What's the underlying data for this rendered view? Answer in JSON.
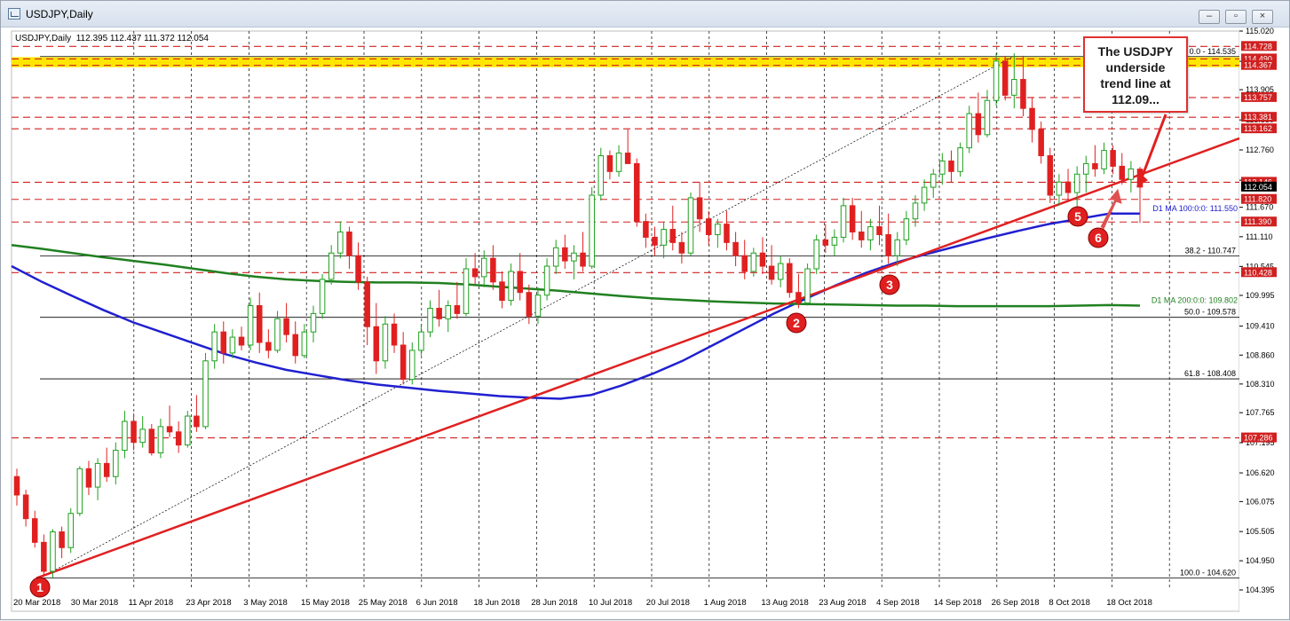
{
  "window": {
    "title": "USDJPY,Daily",
    "controls": {
      "minimize": "–",
      "maximize": "▫",
      "close": "×"
    }
  },
  "header": {
    "symbol_line": "USDJPY,Daily  112.395 112.437 111.372 112.054"
  },
  "callout": {
    "lines": [
      "The USDJPY",
      "underside",
      "trend line at",
      "112.09..."
    ]
  },
  "colors": {
    "bull": "#1fa01f",
    "bear": "#e02020",
    "trendline": "#e02020",
    "ma100": "#2020d0",
    "ma200": "#208020",
    "highlight": "#ffe600",
    "marker": "#e02020"
  },
  "chart_data": {
    "type": "candlestick",
    "symbol": "USDJPY",
    "timeframe": "Daily",
    "ohlc_last": {
      "open": 112.395,
      "high": 112.437,
      "low": 111.372,
      "close": 112.054
    },
    "ylim": [
      104.395,
      115.02
    ],
    "y_ticks": [
      "115.020",
      "114.445",
      "113.905",
      "113.330",
      "112.760",
      "112.185",
      "111.670",
      "111.110",
      "110.545",
      "109.995",
      "109.410",
      "108.860",
      "108.310",
      "107.765",
      "107.195",
      "106.620",
      "106.075",
      "105.505",
      "104.950",
      "104.395"
    ],
    "x_ticks": [
      "20 Mar 2018",
      "30 Mar 2018",
      "11 Apr 2018",
      "23 Apr 2018",
      "3 May 2018",
      "15 May 2018",
      "25 May 2018",
      "6 Jun 2018",
      "18 Jun 2018",
      "28 Jun 2018",
      "10 Jul 2018",
      "20 Jul 2018",
      "1 Aug 2018",
      "13 Aug 2018",
      "23 Aug 2018",
      "4 Sep 2018",
      "14 Sep 2018",
      "26 Sep 2018",
      "8 Oct 2018",
      "18 Oct 2018"
    ],
    "price_labels": [
      {
        "value": 114.728,
        "label": "114.728",
        "style": "red"
      },
      {
        "value": 114.49,
        "label": "114.490",
        "style": "red"
      },
      {
        "value": 114.367,
        "label": "114.367",
        "style": "red"
      },
      {
        "value": 113.757,
        "label": "113.757",
        "style": "red"
      },
      {
        "value": 113.381,
        "label": "113.381",
        "style": "red"
      },
      {
        "value": 113.162,
        "label": "113.162",
        "style": "red"
      },
      {
        "value": 112.146,
        "label": "112.146",
        "style": "red"
      },
      {
        "value": 112.054,
        "label": "112.054",
        "style": "black"
      },
      {
        "value": 111.82,
        "label": "111.820",
        "style": "red"
      },
      {
        "value": 111.39,
        "label": "111.390",
        "style": "red"
      },
      {
        "value": 110.428,
        "label": "110.428",
        "style": "red"
      },
      {
        "value": 107.286,
        "label": "107.286",
        "style": "red"
      }
    ],
    "horizontal_lines": [
      {
        "value": 114.728,
        "style": "red-dash"
      },
      {
        "value": 114.49,
        "style": "red-dash"
      },
      {
        "value": 114.367,
        "style": "red-dash"
      },
      {
        "value": 113.757,
        "style": "red-dash"
      },
      {
        "value": 113.381,
        "style": "red-dash"
      },
      {
        "value": 113.162,
        "style": "red-dash"
      },
      {
        "value": 112.146,
        "style": "red-dash"
      },
      {
        "value": 111.82,
        "style": "red-dash"
      },
      {
        "value": 111.39,
        "style": "red-dash"
      },
      {
        "value": 110.428,
        "style": "red-dash"
      },
      {
        "value": 107.286,
        "style": "red-dash"
      }
    ],
    "highlight_band": [
      114.367,
      114.49
    ],
    "fibonacci": {
      "levels": [
        {
          "value": 114.535,
          "label": "0.0 - 114.535"
        },
        {
          "value": 110.747,
          "label": "38.2 - 110.747"
        },
        {
          "value": 109.578,
          "label": "50.0 - 109.578"
        },
        {
          "value": 108.408,
          "label": "61.8 - 108.408"
        },
        {
          "value": 104.62,
          "label": "100.0 - 104.620"
        }
      ]
    },
    "ma_labels": [
      {
        "label": "D1 MA 100:0:0: 111.550",
        "value": 111.55,
        "color": "#2020d0"
      },
      {
        "label": "D1 MA 200:0:0: 109.802",
        "value": 109.802,
        "color": "#208020"
      }
    ],
    "trendline": {
      "from": [
        "20 Mar 2018",
        104.62
      ],
      "to": [
        "18 Oct 2018",
        112.09
      ]
    },
    "markers": [
      "1",
      "2",
      "3",
      "5",
      "6"
    ],
    "series": [
      {
        "name": "D1 MA 100",
        "values": [
          110.55,
          110.25,
          109.98,
          109.72,
          109.48,
          109.28,
          109.08,
          108.88,
          108.72,
          108.58,
          108.48,
          108.38,
          108.3,
          108.24,
          108.18,
          108.13,
          108.08,
          108.05,
          108.03,
          108.1,
          108.28,
          108.5,
          108.75,
          109.05,
          109.35,
          109.65,
          109.92,
          110.18,
          110.42,
          110.62,
          110.78,
          110.93,
          111.08,
          111.22,
          111.35,
          111.45,
          111.55,
          111.55
        ]
      },
      {
        "name": "D1 MA 200",
        "values": [
          110.95,
          110.88,
          110.8,
          110.72,
          110.65,
          110.58,
          110.5,
          110.42,
          110.35,
          110.3,
          110.27,
          110.25,
          110.24,
          110.24,
          110.23,
          110.2,
          110.16,
          110.12,
          110.08,
          110.03,
          109.98,
          109.94,
          109.91,
          109.88,
          109.86,
          109.84,
          109.83,
          109.82,
          109.81,
          109.8,
          109.8,
          109.79,
          109.79,
          109.79,
          109.79,
          109.8,
          109.81,
          109.8
        ]
      }
    ],
    "candles": [
      [
        106.55,
        106.7,
        106.0,
        106.2
      ],
      [
        106.2,
        106.3,
        105.6,
        105.75
      ],
      [
        105.75,
        105.9,
        105.2,
        105.3
      ],
      [
        105.3,
        105.45,
        104.64,
        104.75
      ],
      [
        104.75,
        105.55,
        104.62,
        105.5
      ],
      [
        105.5,
        105.6,
        105.0,
        105.2
      ],
      [
        105.2,
        105.95,
        105.1,
        105.85
      ],
      [
        105.85,
        106.75,
        105.8,
        106.7
      ],
      [
        106.7,
        106.85,
        106.2,
        106.35
      ],
      [
        106.35,
        106.9,
        106.1,
        106.8
      ],
      [
        106.8,
        107.1,
        106.45,
        106.55
      ],
      [
        106.55,
        107.2,
        106.4,
        107.05
      ],
      [
        107.05,
        107.8,
        106.9,
        107.6
      ],
      [
        107.6,
        107.75,
        107.05,
        107.2
      ],
      [
        107.2,
        107.7,
        107.1,
        107.45
      ],
      [
        107.45,
        107.55,
        106.95,
        107.0
      ],
      [
        107.0,
        107.65,
        106.9,
        107.5
      ],
      [
        107.5,
        107.9,
        107.3,
        107.4
      ],
      [
        107.4,
        107.6,
        107.0,
        107.15
      ],
      [
        107.15,
        107.8,
        107.1,
        107.7
      ],
      [
        107.7,
        108.1,
        107.4,
        107.5
      ],
      [
        107.5,
        108.9,
        107.45,
        108.75
      ],
      [
        108.75,
        109.45,
        108.6,
        109.3
      ],
      [
        109.3,
        109.5,
        108.7,
        108.9
      ],
      [
        108.9,
        109.35,
        108.8,
        109.2
      ],
      [
        109.2,
        109.4,
        108.95,
        109.05
      ],
      [
        109.05,
        109.95,
        108.95,
        109.8
      ],
      [
        109.8,
        110.05,
        108.9,
        109.1
      ],
      [
        109.1,
        109.35,
        108.8,
        108.95
      ],
      [
        108.95,
        109.7,
        108.9,
        109.55
      ],
      [
        109.55,
        109.85,
        109.1,
        109.25
      ],
      [
        109.25,
        109.5,
        108.7,
        108.85
      ],
      [
        108.85,
        109.45,
        108.8,
        109.3
      ],
      [
        109.3,
        109.8,
        109.1,
        109.65
      ],
      [
        109.65,
        110.4,
        109.55,
        110.3
      ],
      [
        110.3,
        110.95,
        110.2,
        110.8
      ],
      [
        110.8,
        111.4,
        110.7,
        111.2
      ],
      [
        111.2,
        111.3,
        110.5,
        110.75
      ],
      [
        110.75,
        111.0,
        110.1,
        110.25
      ],
      [
        110.25,
        110.35,
        109.05,
        109.4
      ],
      [
        109.4,
        109.85,
        108.5,
        108.75
      ],
      [
        108.75,
        109.6,
        108.6,
        109.45
      ],
      [
        109.45,
        109.65,
        108.9,
        109.05
      ],
      [
        109.05,
        109.3,
        108.3,
        108.4
      ],
      [
        108.4,
        109.1,
        108.3,
        108.95
      ],
      [
        108.95,
        109.45,
        108.85,
        109.3
      ],
      [
        109.3,
        109.9,
        109.2,
        109.75
      ],
      [
        109.75,
        110.1,
        109.4,
        109.55
      ],
      [
        109.55,
        109.9,
        109.3,
        109.8
      ],
      [
        109.8,
        110.25,
        109.55,
        109.65
      ],
      [
        109.65,
        110.7,
        109.6,
        110.5
      ],
      [
        110.5,
        110.8,
        110.2,
        110.35
      ],
      [
        110.35,
        110.85,
        110.15,
        110.7
      ],
      [
        110.7,
        110.95,
        110.1,
        110.25
      ],
      [
        110.25,
        110.45,
        109.75,
        109.9
      ],
      [
        109.9,
        110.6,
        109.8,
        110.45
      ],
      [
        110.45,
        110.8,
        109.9,
        110.05
      ],
      [
        110.05,
        110.2,
        109.45,
        109.6
      ],
      [
        109.6,
        110.15,
        109.45,
        110.0
      ],
      [
        110.0,
        110.7,
        109.9,
        110.55
      ],
      [
        110.55,
        111.05,
        110.4,
        110.9
      ],
      [
        110.9,
        111.15,
        110.5,
        110.65
      ],
      [
        110.65,
        110.95,
        110.3,
        110.8
      ],
      [
        110.8,
        111.2,
        110.45,
        110.55
      ],
      [
        110.55,
        112.05,
        110.5,
        111.9
      ],
      [
        111.9,
        112.8,
        111.8,
        112.65
      ],
      [
        112.65,
        112.75,
        112.2,
        112.35
      ],
      [
        112.35,
        112.85,
        112.25,
        112.7
      ],
      [
        112.7,
        113.15,
        112.6,
        112.5
      ],
      [
        112.5,
        112.6,
        111.3,
        111.4
      ],
      [
        111.4,
        111.55,
        110.9,
        111.1
      ],
      [
        111.1,
        111.3,
        110.75,
        110.95
      ],
      [
        110.95,
        111.4,
        110.7,
        111.25
      ],
      [
        111.25,
        111.7,
        110.85,
        111.0
      ],
      [
        111.0,
        111.2,
        110.6,
        110.8
      ],
      [
        110.8,
        111.95,
        110.75,
        111.85
      ],
      [
        111.85,
        112.15,
        111.2,
        111.45
      ],
      [
        111.45,
        111.6,
        110.95,
        111.15
      ],
      [
        111.15,
        111.45,
        110.9,
        111.35
      ],
      [
        111.35,
        111.6,
        110.85,
        111.0
      ],
      [
        111.0,
        111.2,
        110.55,
        110.75
      ],
      [
        110.75,
        111.05,
        110.3,
        110.45
      ],
      [
        110.45,
        110.9,
        110.35,
        110.8
      ],
      [
        110.8,
        111.1,
        110.4,
        110.55
      ],
      [
        110.55,
        110.95,
        110.2,
        110.3
      ],
      [
        110.3,
        110.75,
        110.15,
        110.6
      ],
      [
        110.6,
        110.7,
        109.95,
        110.05
      ],
      [
        110.05,
        110.4,
        109.75,
        109.85
      ],
      [
        109.85,
        110.6,
        109.8,
        110.5
      ],
      [
        110.5,
        111.15,
        110.4,
        111.05
      ],
      [
        111.05,
        111.35,
        110.8,
        110.95
      ],
      [
        110.95,
        111.25,
        110.75,
        111.1
      ],
      [
        111.1,
        111.85,
        111.0,
        111.7
      ],
      [
        111.7,
        111.85,
        111.05,
        111.2
      ],
      [
        111.2,
        111.6,
        110.9,
        111.05
      ],
      [
        111.05,
        111.45,
        110.85,
        111.3
      ],
      [
        111.3,
        111.7,
        110.95,
        111.15
      ],
      [
        111.15,
        111.55,
        110.6,
        110.75
      ],
      [
        110.75,
        111.2,
        110.55,
        111.05
      ],
      [
        111.05,
        111.6,
        110.95,
        111.45
      ],
      [
        111.45,
        111.9,
        111.3,
        111.75
      ],
      [
        111.75,
        112.2,
        111.6,
        112.05
      ],
      [
        112.05,
        112.4,
        111.85,
        112.3
      ],
      [
        112.3,
        112.7,
        112.1,
        112.55
      ],
      [
        112.55,
        112.75,
        112.15,
        112.35
      ],
      [
        112.35,
        112.9,
        112.25,
        112.8
      ],
      [
        112.8,
        113.6,
        112.7,
        113.45
      ],
      [
        113.45,
        113.85,
        112.9,
        113.05
      ],
      [
        113.05,
        113.9,
        113.0,
        113.7
      ],
      [
        113.7,
        114.6,
        113.6,
        114.45
      ],
      [
        114.45,
        114.55,
        113.7,
        113.8
      ],
      [
        113.8,
        114.6,
        113.55,
        114.1
      ],
      [
        114.1,
        114.55,
        113.4,
        113.55
      ],
      [
        113.55,
        113.75,
        112.9,
        113.15
      ],
      [
        113.15,
        113.3,
        112.5,
        112.65
      ],
      [
        112.65,
        112.8,
        111.75,
        111.9
      ],
      [
        111.9,
        112.3,
        111.7,
        112.15
      ],
      [
        112.15,
        112.4,
        111.8,
        111.95
      ],
      [
        111.95,
        112.45,
        111.65,
        112.3
      ],
      [
        112.3,
        112.65,
        111.95,
        112.5
      ],
      [
        112.5,
        112.85,
        112.25,
        112.4
      ],
      [
        112.4,
        112.9,
        112.3,
        112.75
      ],
      [
        112.75,
        112.85,
        112.3,
        112.45
      ],
      [
        112.45,
        112.7,
        112.1,
        112.2
      ],
      [
        112.2,
        112.55,
        111.95,
        112.4
      ],
      [
        112.395,
        112.437,
        111.372,
        112.054
      ]
    ]
  }
}
